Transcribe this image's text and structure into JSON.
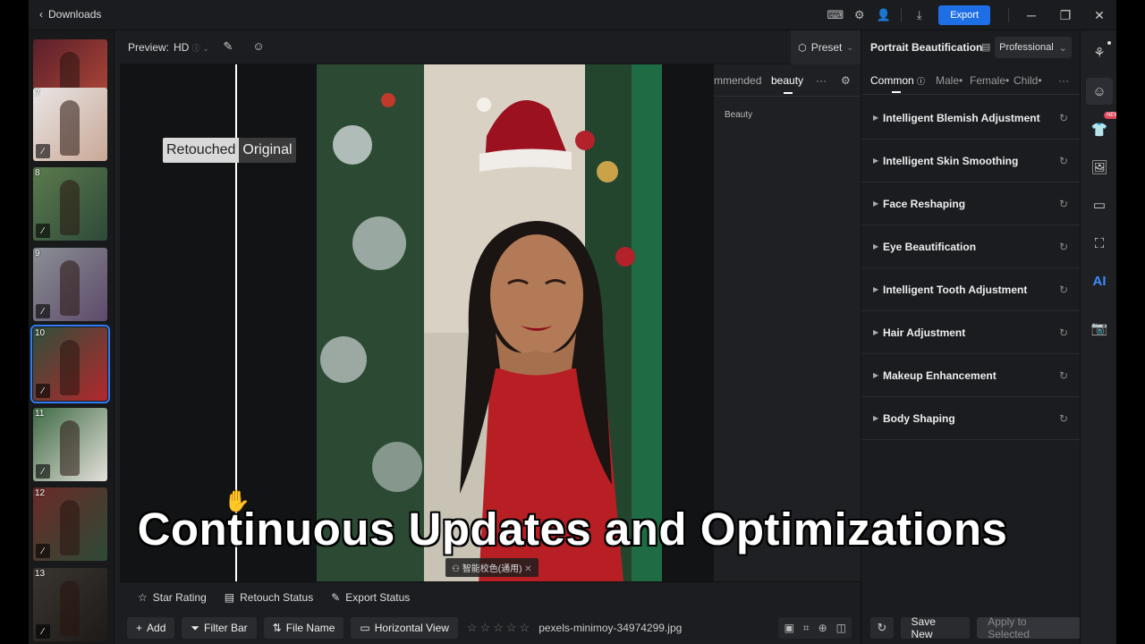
{
  "titlebar": {
    "back_label": "Downloads",
    "export_label": "Export"
  },
  "filmstrip": {
    "thumbs": [
      {
        "num": "",
        "colors": [
          "#5a1f2a",
          "#b54a3a"
        ]
      },
      {
        "num": "7",
        "colors": [
          "#e9e6e6",
          "#c9a896"
        ]
      },
      {
        "num": "8",
        "colors": [
          "#5b7a4c",
          "#2e4a3a"
        ]
      },
      {
        "num": "9",
        "colors": [
          "#8a8f94",
          "#5e4a6b"
        ]
      },
      {
        "num": "10",
        "colors": [
          "#2f4f3a",
          "#b5272d"
        ]
      },
      {
        "num": "11",
        "colors": [
          "#3f6a45",
          "#e4e1db"
        ]
      },
      {
        "num": "12",
        "colors": [
          "#6b2a27",
          "#2d4a37"
        ]
      },
      {
        "num": "13",
        "colors": [
          "#3a3530",
          "#1e1a18"
        ]
      }
    ],
    "selected_index": 4
  },
  "preview": {
    "label": "Preview:",
    "quality": "HD",
    "preset_label": "Preset"
  },
  "canvas": {
    "retouched_label": "Retouched",
    "original_label": "Original",
    "preset_tag": "智能校色(通用)"
  },
  "beauty_panel": {
    "tab_recommended": "mmended",
    "tab_beauty": "beauty",
    "item": "Beauty"
  },
  "bottom_bar": {
    "star_rating": "Star Rating",
    "retouch_status": "Retouch Status",
    "export_status": "Export Status",
    "add": "Add",
    "filter_bar": "Filter Bar",
    "file_name": "File Name",
    "horizontal_view": "Horizontal View",
    "filename": "pexels-minimoy-34974299.jpg",
    "stars": 0
  },
  "right_panel": {
    "title": "Portrait Beautification",
    "mode": "Professional",
    "tabs": [
      "Common",
      "Male",
      "Female",
      "Child"
    ],
    "items": [
      "Intelligent Blemish Adjustment",
      "Intelligent Skin Smoothing",
      "Face Reshaping",
      "Eye Beautification",
      "Intelligent Tooth Adjustment",
      "Hair Adjustment",
      "Makeup Enhancement",
      "Body Shaping"
    ],
    "save_new": "Save New",
    "apply_selected": "Apply to Selected"
  },
  "rail": {
    "new_badge": "NEW",
    "ai_label": "AI"
  },
  "subtitle": "Continuous Updates and Optimizations",
  "colors": {
    "accent": "#1e6fe6",
    "selection": "#2f7cf6",
    "dress": "#b81f25"
  }
}
